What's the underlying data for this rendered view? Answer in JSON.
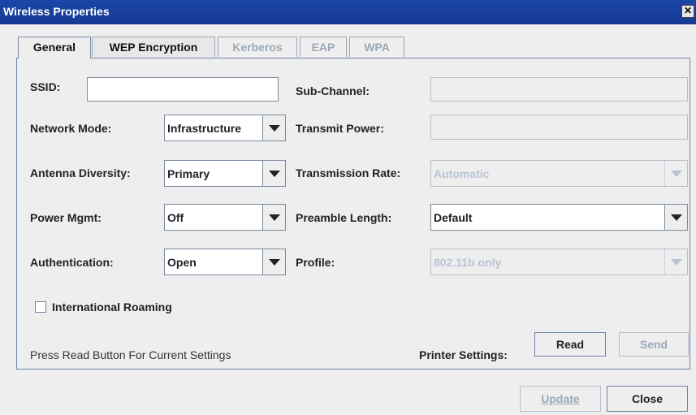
{
  "window": {
    "title": "Wireless Properties",
    "close_glyph": "✕"
  },
  "tabs": [
    {
      "label": "General",
      "state": "active"
    },
    {
      "label": "WEP Encryption",
      "state": "enabled"
    },
    {
      "label": "Kerberos",
      "state": "disabled"
    },
    {
      "label": "EAP",
      "state": "disabled"
    },
    {
      "label": "WPA",
      "state": "disabled"
    }
  ],
  "fields": {
    "ssid": {
      "label": "SSID:",
      "value": ""
    },
    "sub_channel": {
      "label": "Sub-Channel:",
      "value": ""
    },
    "network_mode": {
      "label": "Network Mode:",
      "value": "Infrastructure"
    },
    "transmit_power": {
      "label": "Transmit Power:",
      "value": ""
    },
    "antenna_diversity": {
      "label": "Antenna Diversity:",
      "value": "Primary"
    },
    "transmission_rate": {
      "label": "Transmission Rate:",
      "value": "Automatic"
    },
    "power_mgmt": {
      "label": "Power Mgmt:",
      "value": "Off"
    },
    "preamble_length": {
      "label": "Preamble Length:",
      "value": "Default"
    },
    "authentication": {
      "label": "Authentication:",
      "value": "Open"
    },
    "profile": {
      "label": "Profile:",
      "value": "802.11b only"
    }
  },
  "international_roaming": {
    "label": "International Roaming",
    "checked": false
  },
  "status_text": "Press Read Button For Current Settings",
  "printer_settings": {
    "label": "Printer Settings:",
    "read": "Read",
    "send": "Send"
  },
  "footer": {
    "update": "Update",
    "close": "Close"
  },
  "colors": {
    "title_bar": "#1c46a8",
    "panel_border": "#6f84a3",
    "disabled_text": "#9ca8b8"
  }
}
